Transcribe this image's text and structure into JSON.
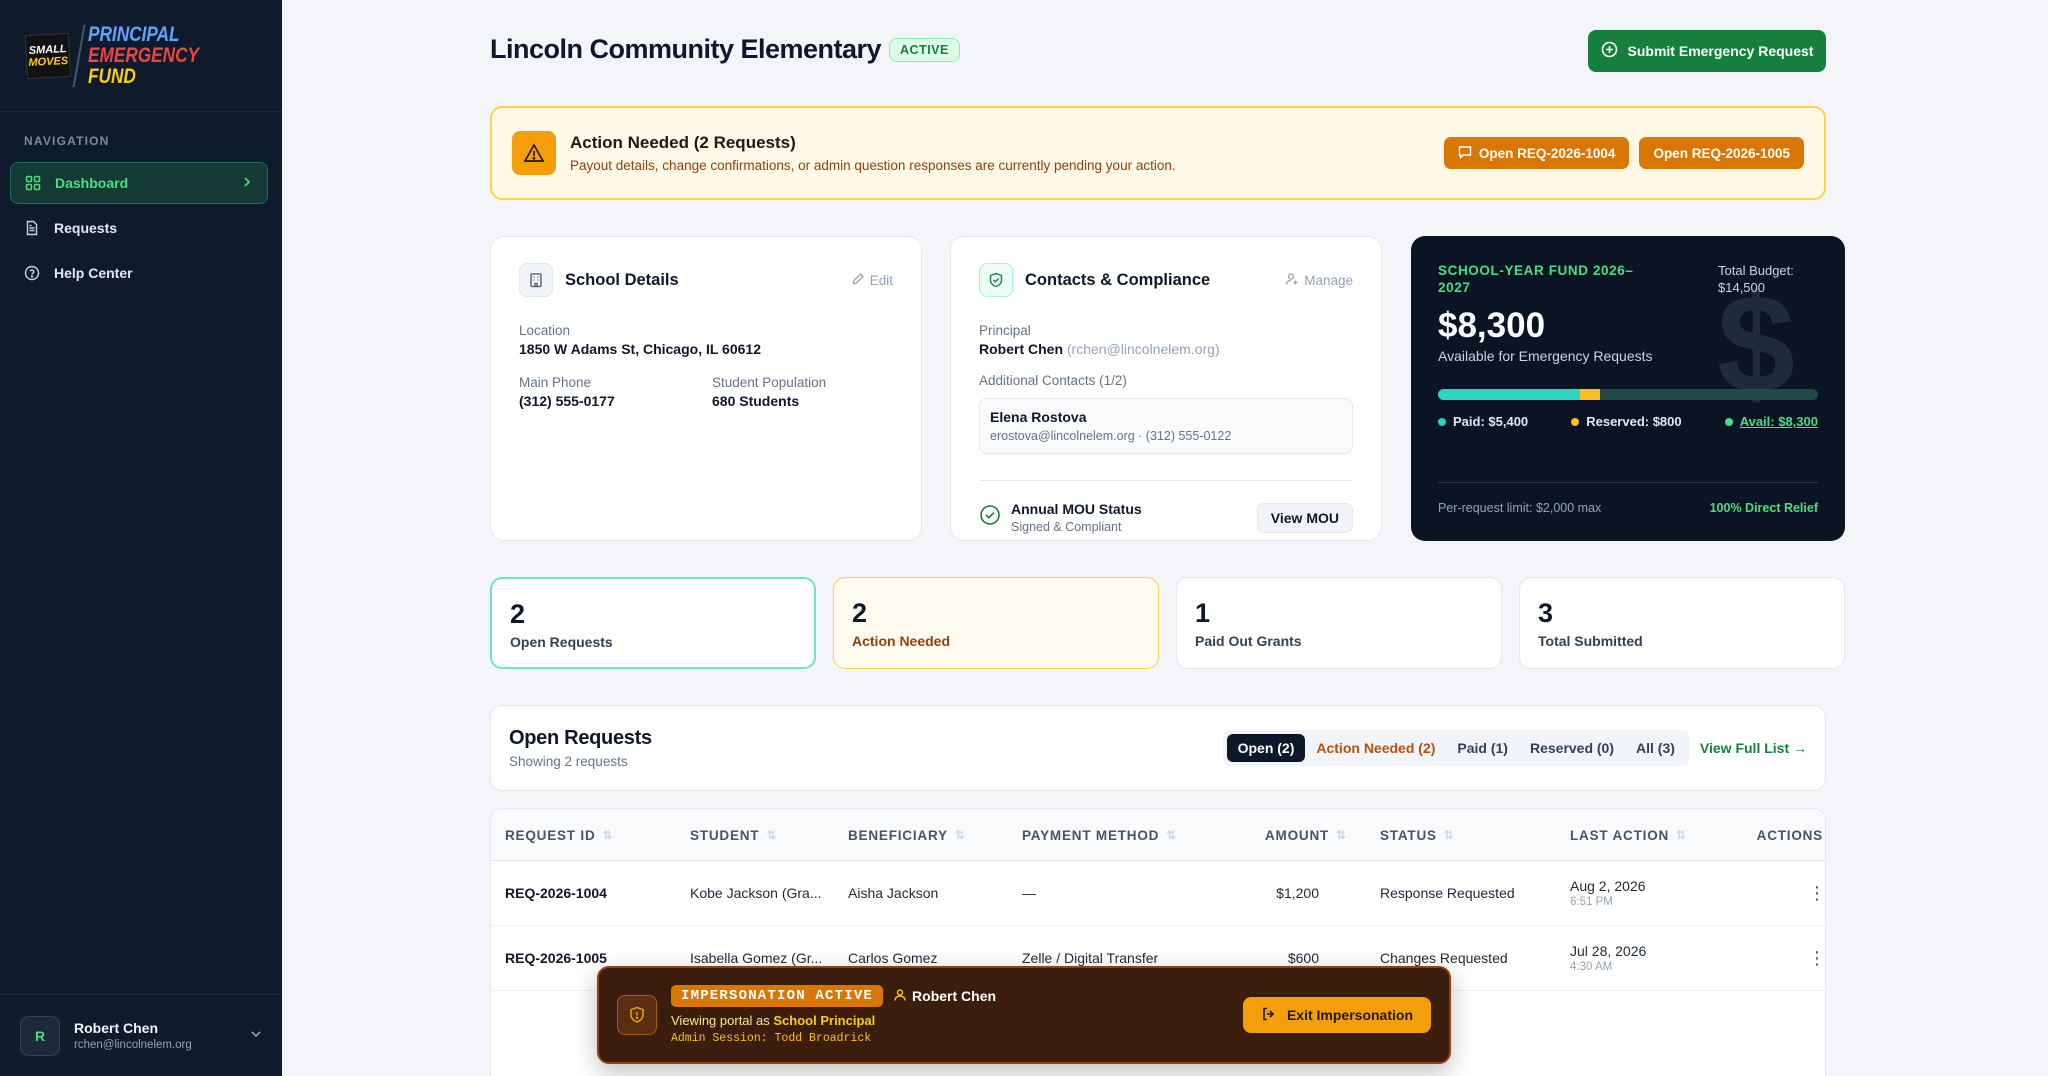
{
  "brand": {
    "logo_line1": "SMALL",
    "logo_line2": "MOVES",
    "title_line1": "PRINCIPAL",
    "title_line2": "EMERGENCY",
    "title_line3": "FUND"
  },
  "sidebar": {
    "heading": "NAVIGATION",
    "items": [
      {
        "label": "Dashboard",
        "icon": "grid-icon",
        "active": true
      },
      {
        "label": "Requests",
        "icon": "document-icon"
      },
      {
        "label": "Help Center",
        "icon": "help-circle-icon"
      }
    ],
    "user": {
      "initial": "R",
      "name": "Robert Chen",
      "email": "rchen@lincolnelem.org"
    }
  },
  "header": {
    "title": "Lincoln Community Elementary",
    "status": "ACTIVE",
    "submit_label": "Submit Emergency Request"
  },
  "alert": {
    "title": "Action Needed (2 Requests)",
    "message": "Payout details, change confirmations, or admin question responses are currently pending your action.",
    "buttons": [
      "Open REQ-2026-1004",
      "Open REQ-2026-1005"
    ]
  },
  "school": {
    "title": "School Details",
    "edit_label": "Edit",
    "location_label": "Location",
    "location": "1850 W Adams St, Chicago, IL 60612",
    "phone_label": "Main Phone",
    "phone": "(312) 555-0177",
    "population_label": "Student Population",
    "population": "680 Students"
  },
  "contacts": {
    "title": "Contacts & Compliance",
    "manage_label": "Manage",
    "principal_label": "Principal",
    "principal_name": "Robert Chen",
    "principal_email": "(rchen@lincolnelem.org)",
    "additional_label": "Additional Contacts (1/2)",
    "additional": {
      "name": "Elena Rostova",
      "detail": "erostova@lincolnelem.org · (312) 555-0122"
    },
    "mou_title": "Annual MOU Status",
    "mou_status": "Signed & Compliant",
    "mou_button": "View MOU"
  },
  "fund": {
    "title": "SCHOOL-YEAR FUND 2026–2027",
    "budget": "Total Budget: $14,500",
    "available_amount": "$8,300",
    "available_label": "Available for Emergency Requests",
    "paid": "Paid: $5,400",
    "reserved": "Reserved: $800",
    "avail": "Avail: $8,300",
    "paid_value": 5400,
    "reserved_value": 800,
    "available_value": 8300,
    "total_value": 14500,
    "limit": "Per-request limit: $2,000 max",
    "relief": "100% Direct Relief",
    "colors": {
      "paid": "#2dd4bf",
      "reserved": "#fbbf24",
      "available": "#1f4a45"
    }
  },
  "stats": [
    {
      "value": "2",
      "label": "Open Requests"
    },
    {
      "value": "2",
      "label": "Action Needed"
    },
    {
      "value": "1",
      "label": "Paid Out Grants"
    },
    {
      "value": "3",
      "label": "Total Submitted"
    }
  ],
  "open_requests": {
    "title": "Open Requests",
    "subtitle": "Showing 2 requests",
    "filters": [
      "Open (2)",
      "Action Needed (2)",
      "Paid (1)",
      "Reserved (0)",
      "All (3)"
    ],
    "view_full": "View Full List →"
  },
  "table": {
    "columns": [
      "REQUEST ID",
      "STUDENT",
      "BENEFICIARY",
      "PAYMENT METHOD",
      "AMOUNT",
      "STATUS",
      "LAST ACTION",
      "ACTIONS"
    ],
    "rows": [
      {
        "id": "REQ-2026-1004",
        "student": "Kobe Jackson (Gra...",
        "beneficiary": "Aisha Jackson",
        "payment": "—",
        "amount": "$1,200",
        "status": "Response Requested",
        "date": "Aug 2, 2026",
        "time": "6:51 PM"
      },
      {
        "id": "REQ-2026-1005",
        "student": "Isabella Gomez (Gr...",
        "beneficiary": "Carlos Gomez",
        "payment": "Zelle / Digital Transfer",
        "amount": "$600",
        "status": "Changes Requested",
        "date": "Jul 28, 2026",
        "time": "4:30 AM"
      }
    ]
  },
  "impersonation": {
    "badge": "IMPERSONATION ACTIVE",
    "user": "Robert Chen",
    "viewing_prefix": "Viewing portal as",
    "role": "School Principal",
    "admin": "Admin Session: Todd Broadrick",
    "exit_label": "Exit Impersonation"
  }
}
